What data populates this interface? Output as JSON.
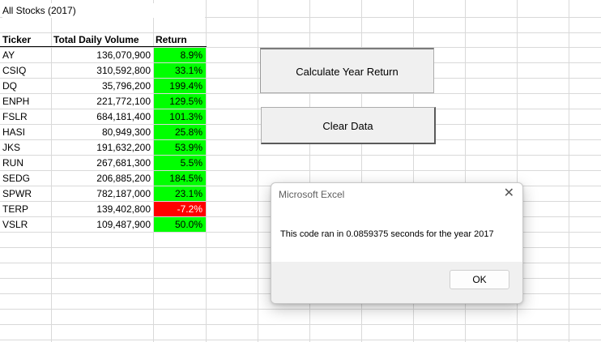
{
  "sheet": {
    "title": "All Stocks (2017)"
  },
  "table": {
    "headers": {
      "ticker": "Ticker",
      "volume": "Total Daily Volume",
      "return": "Return"
    },
    "rows": [
      {
        "ticker": "AY",
        "volume": "136,070,900",
        "return": "8.9%",
        "status": "positive"
      },
      {
        "ticker": "CSIQ",
        "volume": "310,592,800",
        "return": "33.1%",
        "status": "positive"
      },
      {
        "ticker": "DQ",
        "volume": "35,796,200",
        "return": "199.4%",
        "status": "positive"
      },
      {
        "ticker": "ENPH",
        "volume": "221,772,100",
        "return": "129.5%",
        "status": "positive"
      },
      {
        "ticker": "FSLR",
        "volume": "684,181,400",
        "return": "101.3%",
        "status": "positive"
      },
      {
        "ticker": "HASI",
        "volume": "80,949,300",
        "return": "25.8%",
        "status": "positive"
      },
      {
        "ticker": "JKS",
        "volume": "191,632,200",
        "return": "53.9%",
        "status": "positive"
      },
      {
        "ticker": "RUN",
        "volume": "267,681,300",
        "return": "5.5%",
        "status": "positive"
      },
      {
        "ticker": "SEDG",
        "volume": "206,885,200",
        "return": "184.5%",
        "status": "positive"
      },
      {
        "ticker": "SPWR",
        "volume": "782,187,000",
        "return": "23.1%",
        "status": "positive"
      },
      {
        "ticker": "TERP",
        "volume": "139,402,800",
        "return": "-7.2%",
        "status": "negative"
      },
      {
        "ticker": "VSLR",
        "volume": "109,487,900",
        "return": "50.0%",
        "status": "positive"
      }
    ]
  },
  "buttons": {
    "calculate_label": "Calculate Year Return",
    "clear_label": "Clear Data"
  },
  "dialog": {
    "title": "Microsoft Excel",
    "close_glyph": "✕",
    "message": "This code ran in 0.0859375 seconds for the year 2017",
    "ok_label": "OK"
  },
  "colors": {
    "positive": "#00ff00",
    "negative": "#ff0000"
  }
}
